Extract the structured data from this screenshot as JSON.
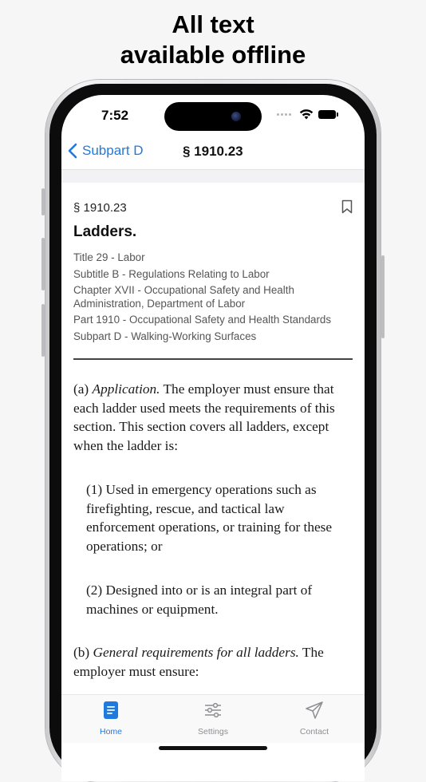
{
  "headline": {
    "line1": "All text",
    "line2": "available offline"
  },
  "status_bar": {
    "time": "7:52"
  },
  "navbar": {
    "back_label": "Subpart D",
    "title": "§ 1910.23"
  },
  "document": {
    "section_number": "§ 1910.23",
    "section_title": "Ladders.",
    "hierarchy": [
      "Title 29 - Labor",
      "Subtitle B - Regulations Relating to Labor",
      "Chapter XVII - Occupational Safety and Health Administration, Department of Labor",
      "Part 1910 - Occupational Safety and Health Standards",
      "Subpart D - Walking-Working Surfaces"
    ],
    "para_a": {
      "label": "(a) ",
      "heading": "Application.",
      "text": " The employer must ensure that each ladder used meets the requirements of this section. This section covers all ladders, except when the ladder is:"
    },
    "para_a1": "(1) Used in emergency operations such as firefighting, rescue, and tactical law enforcement operations, or training for these operations; or",
    "para_a2": "(2) Designed into or is an integral part of machines or equipment.",
    "para_b": {
      "label": "(b) ",
      "heading": "General requirements for all ladders.",
      "text": " The employer must ensure:"
    }
  },
  "tabbar": {
    "items": [
      {
        "label": "Home",
        "icon": "document-icon",
        "active": true
      },
      {
        "label": "Settings",
        "icon": "sliders-icon",
        "active": false
      },
      {
        "label": "Contact",
        "icon": "paper-plane-icon",
        "active": false
      }
    ]
  },
  "colors": {
    "accent": "#1f7ae0",
    "inactive": "#8e8e93"
  }
}
